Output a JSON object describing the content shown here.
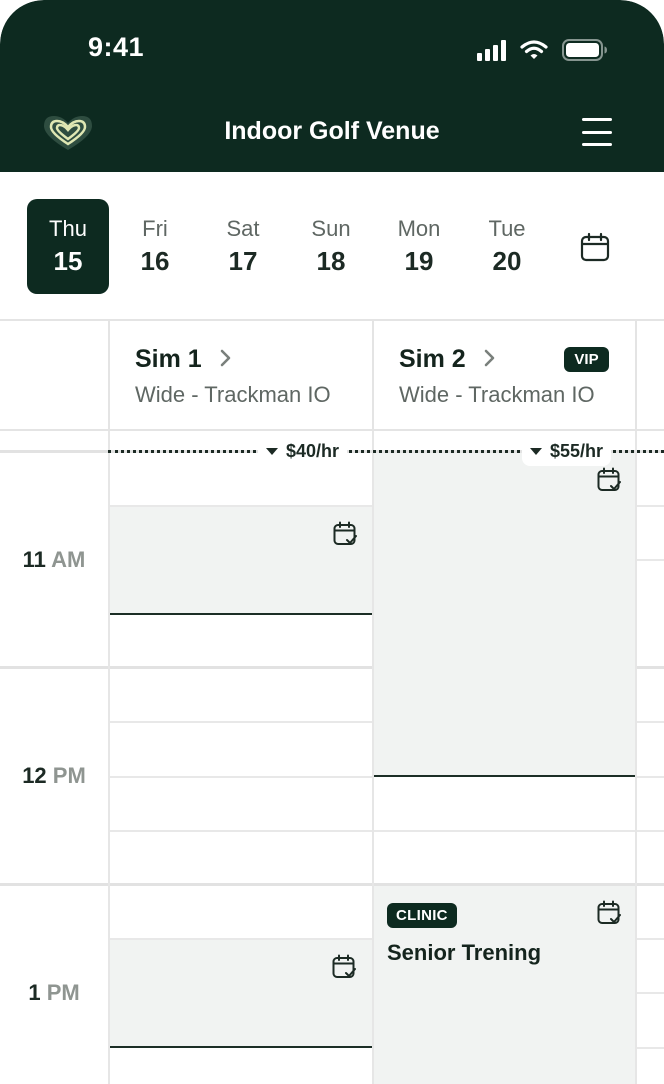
{
  "status_bar": {
    "time": "9:41"
  },
  "header": {
    "title": "Indoor Golf Venue",
    "logo_icon": "heart-logo-icon",
    "menu_icon": "hamburger-menu-icon"
  },
  "date_strip": {
    "days": [
      {
        "dow": "Thu",
        "num": "15",
        "selected": true
      },
      {
        "dow": "Fri",
        "num": "16",
        "selected": false
      },
      {
        "dow": "Sat",
        "num": "17",
        "selected": false
      },
      {
        "dow": "Sun",
        "num": "18",
        "selected": false
      },
      {
        "dow": "Mon",
        "num": "19",
        "selected": false
      },
      {
        "dow": "Tue",
        "num": "20",
        "selected": false
      }
    ],
    "calendar_icon": "calendar-icon"
  },
  "resources": [
    {
      "name": "Sim 1",
      "subtitle": "Wide - Trackman IO",
      "price": "$40/hr"
    },
    {
      "name": "Sim 2",
      "subtitle": "Wide - Trackman IO",
      "price": "$55/hr",
      "badge": "VIP"
    }
  ],
  "hours": [
    {
      "hour": "11",
      "ampm": "AM"
    },
    {
      "hour": "12",
      "ampm": "PM"
    },
    {
      "hour": "1",
      "ampm": "PM"
    }
  ],
  "event": {
    "badge": "CLINIC",
    "title": "Senior Trening"
  },
  "colors": {
    "brand_dark": "#0d2a20",
    "block_bg": "#f1f3f2",
    "line": "#e4e4e4"
  }
}
